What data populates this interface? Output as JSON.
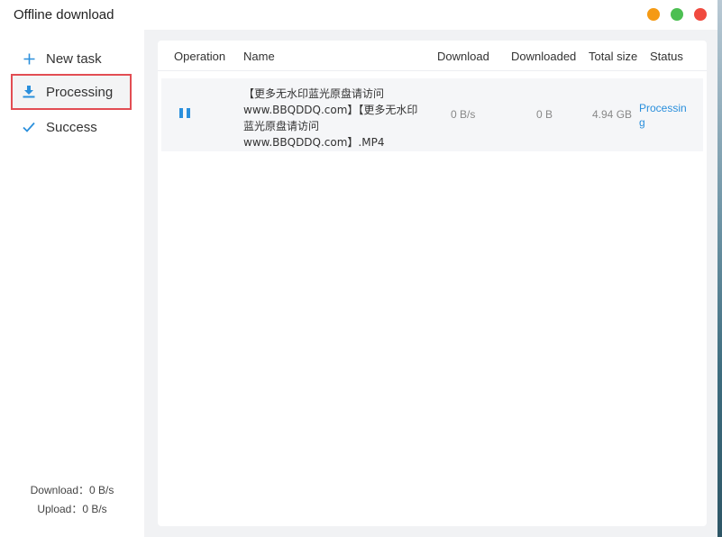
{
  "window": {
    "title": "Offline download",
    "controls": {
      "minimize": "#f59a14",
      "maximize": "#4cbf52",
      "close": "#f04a3f"
    }
  },
  "sidebar": {
    "items": [
      {
        "label": "New task",
        "icon": "plus-icon"
      },
      {
        "label": "Processing",
        "icon": "download-icon",
        "selected": true
      },
      {
        "label": "Success",
        "icon": "check-icon"
      }
    ],
    "download_speed": "Download：0 B/s",
    "upload_speed": "Upload：0 B/s"
  },
  "table": {
    "columns": [
      "Operation",
      "Name",
      "Download",
      "Downloaded",
      "Total size",
      "Status"
    ],
    "rows": [
      {
        "operation": "pause-icon",
        "name": "【更多无水印蓝光原盘请访问www.BBQDDQ.com】【更多无水印蓝光原盘请访问www.BBQDDQ.com】.MP4",
        "download": "0 B/s",
        "downloaded": "0 B",
        "total_size": "4.94 GB",
        "status": "Processing"
      }
    ]
  },
  "colors": {
    "accent": "#2a8fdc",
    "highlight_border": "#e24d53"
  }
}
